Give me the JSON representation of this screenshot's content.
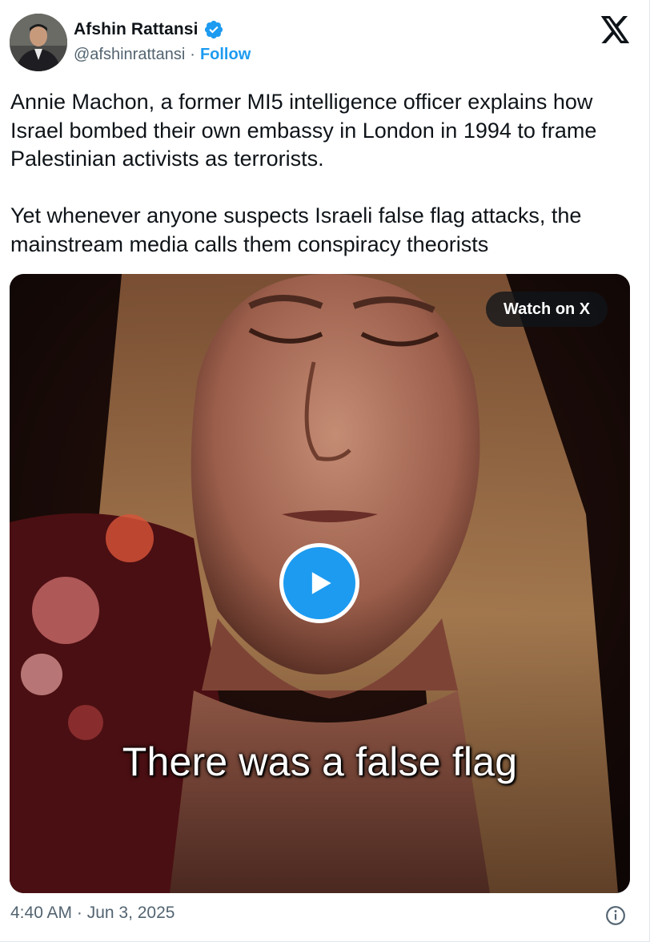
{
  "author": {
    "name": "Afshin Rattansi",
    "handle": "@afshinrattansi",
    "separator": "·",
    "follow_label": "Follow",
    "verified_icon": "verified-badge-icon",
    "verified_color": "#1d9bf0"
  },
  "platform_icon": "x-logo-icon",
  "tweet": {
    "text": "Annie Machon, a former MI5 intelligence officer explains how Israel bombed their own embassy in London in 1994 to frame Palestinian activists as terrorists.\n\nYet whenever anyone suspects Israeli false flag attacks, the mainstream media calls them conspiracy theorists"
  },
  "media": {
    "watch_label": "Watch on X",
    "caption": "There was a false flag",
    "play_icon": "play-icon",
    "accent": "#1d9bf0"
  },
  "footer": {
    "timestamp": "4:40 AM · Jun 3, 2025",
    "info_icon": "info-icon"
  },
  "colors": {
    "text": "#0f1419",
    "secondary": "#536471",
    "link": "#1d9bf0"
  }
}
